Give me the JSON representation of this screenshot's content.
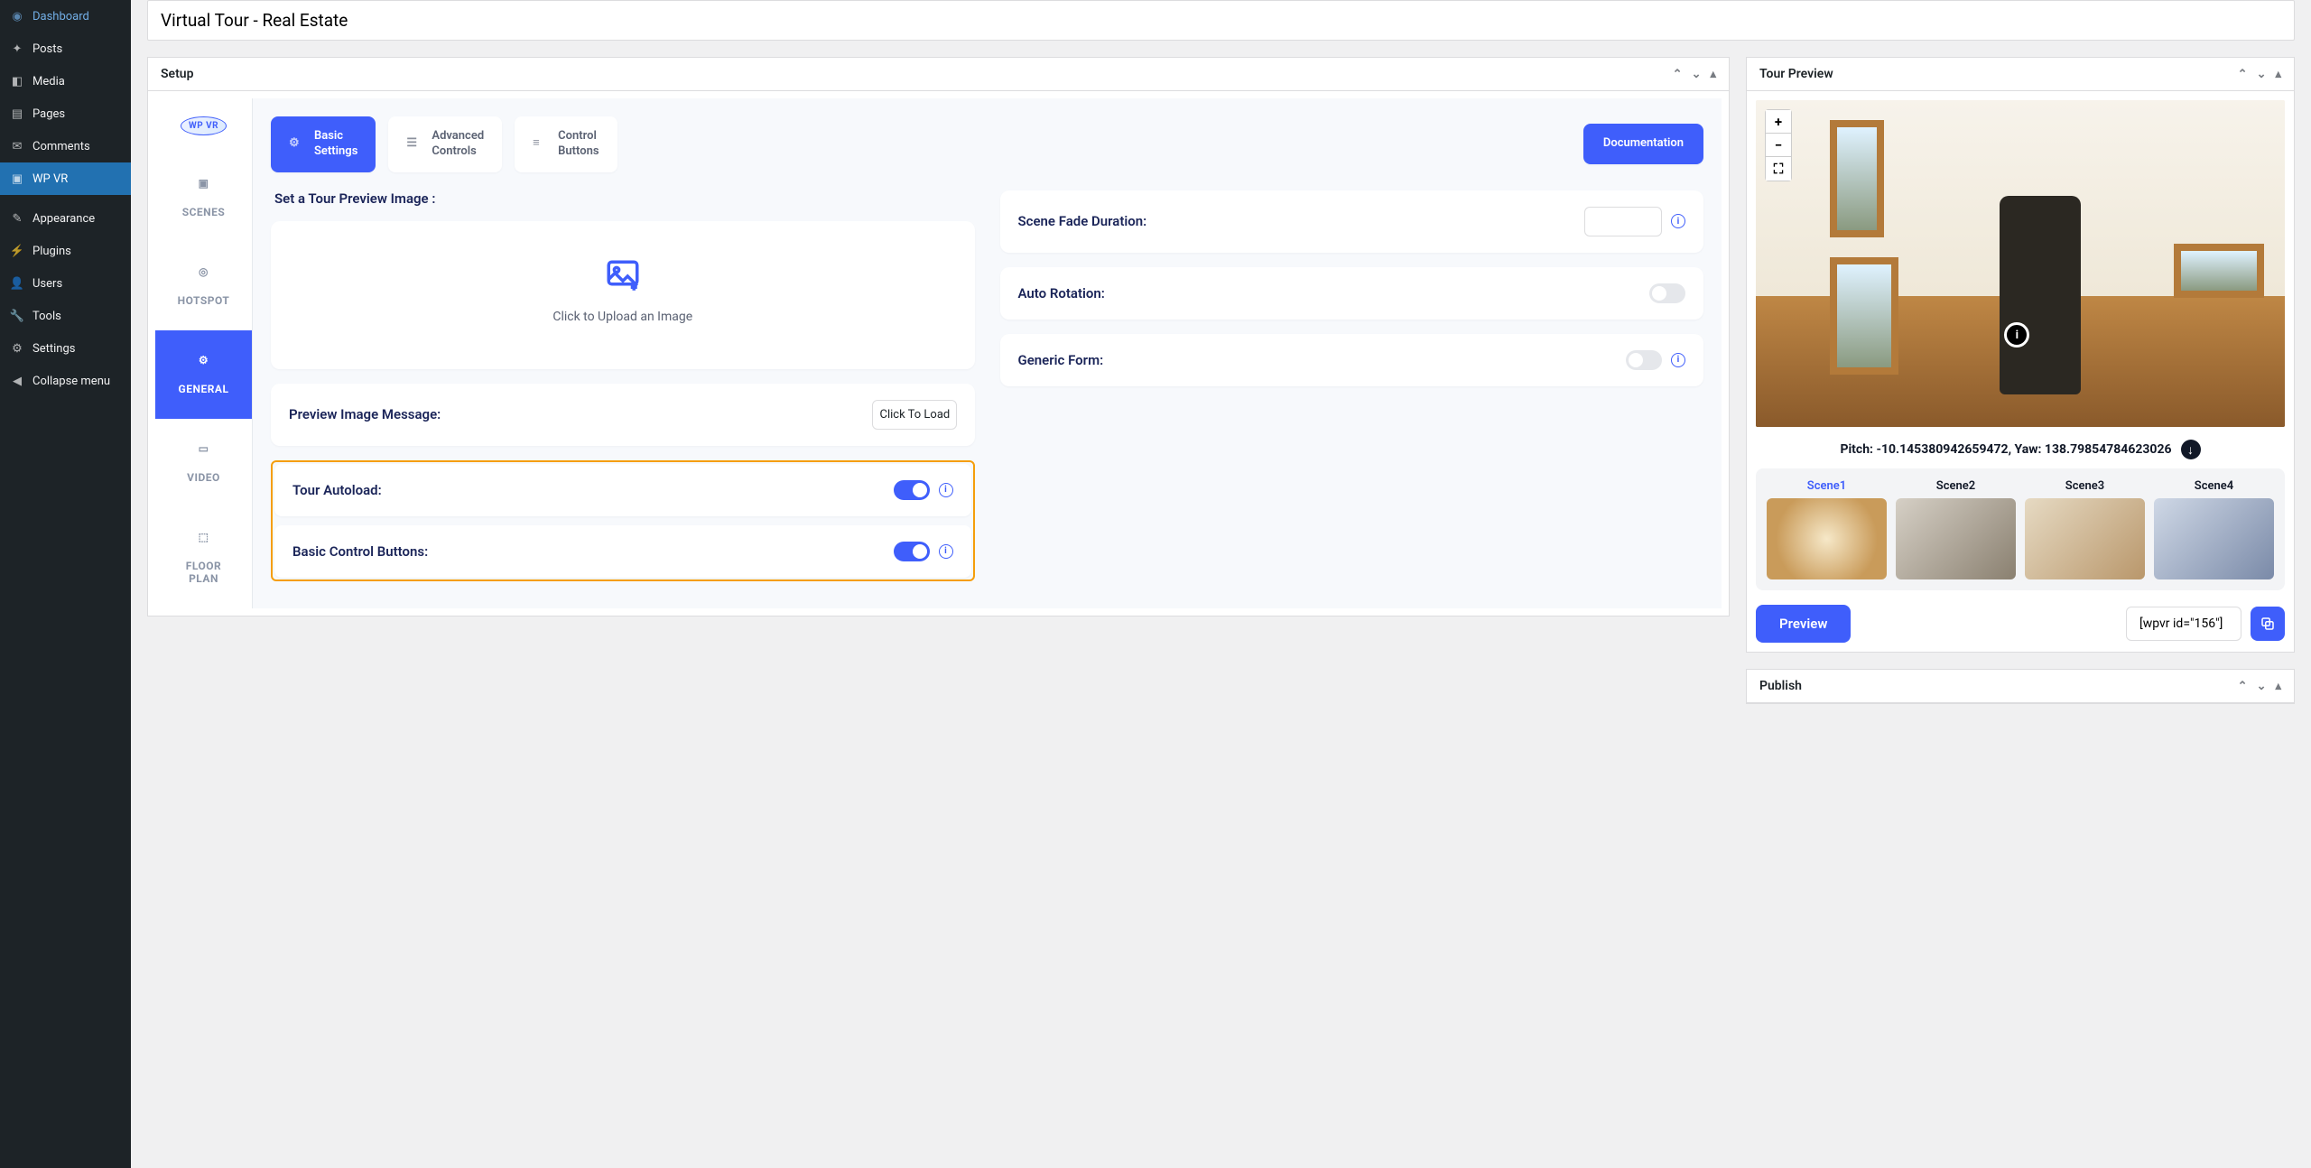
{
  "sidebar": {
    "items": [
      {
        "label": "Dashboard",
        "icon": "gauge"
      },
      {
        "label": "Posts",
        "icon": "pin"
      },
      {
        "label": "Media",
        "icon": "media"
      },
      {
        "label": "Pages",
        "icon": "page"
      },
      {
        "label": "Comments",
        "icon": "comment"
      },
      {
        "label": "WP VR",
        "icon": "vr",
        "active": true
      },
      {
        "label": "Appearance",
        "icon": "brush"
      },
      {
        "label": "Plugins",
        "icon": "plug"
      },
      {
        "label": "Users",
        "icon": "user"
      },
      {
        "label": "Tools",
        "icon": "tools"
      },
      {
        "label": "Settings",
        "icon": "settings"
      },
      {
        "label": "Collapse menu",
        "icon": "collapse"
      }
    ]
  },
  "title": "Virtual Tour - Real Estate",
  "setup": {
    "box_title": "Setup",
    "vtabs": {
      "logo": "WP VR",
      "scenes": "SCENES",
      "hotspot": "HOTSPOT",
      "general": "GENERAL",
      "video": "VIDEO",
      "floorplan_l1": "FLOOR",
      "floorplan_l2": "PLAN"
    },
    "htabs": {
      "basic_l1": "Basic",
      "basic_l2": "Settings",
      "advanced_l1": "Advanced",
      "advanced_l2": "Controls",
      "control_l1": "Control",
      "control_l2": "Buttons",
      "documentation": "Documentation"
    },
    "fields": {
      "set_preview_label": "Set a Tour Preview Image :",
      "upload_text": "Click to Upload an Image",
      "preview_msg_label": "Preview Image Message:",
      "preview_msg_value": "Click To Load",
      "autoload_label": "Tour Autoload:",
      "basic_controls_label": "Basic Control Buttons:",
      "fade_label": "Scene Fade Duration:",
      "fade_value": "",
      "autorotation_label": "Auto Rotation:",
      "generic_form_label": "Generic Form:"
    }
  },
  "preview": {
    "box_title": "Tour Preview",
    "zoom_in": "+",
    "zoom_out": "−",
    "pitch_label": "Pitch: -10.145380942659472, Yaw: 138.79854784623026",
    "scenes": [
      "Scene1",
      "Scene2",
      "Scene3",
      "Scene4"
    ],
    "preview_btn": "Preview",
    "shortcode": "[wpvr id=\"156\"]"
  },
  "publish": {
    "box_title": "Publish"
  }
}
